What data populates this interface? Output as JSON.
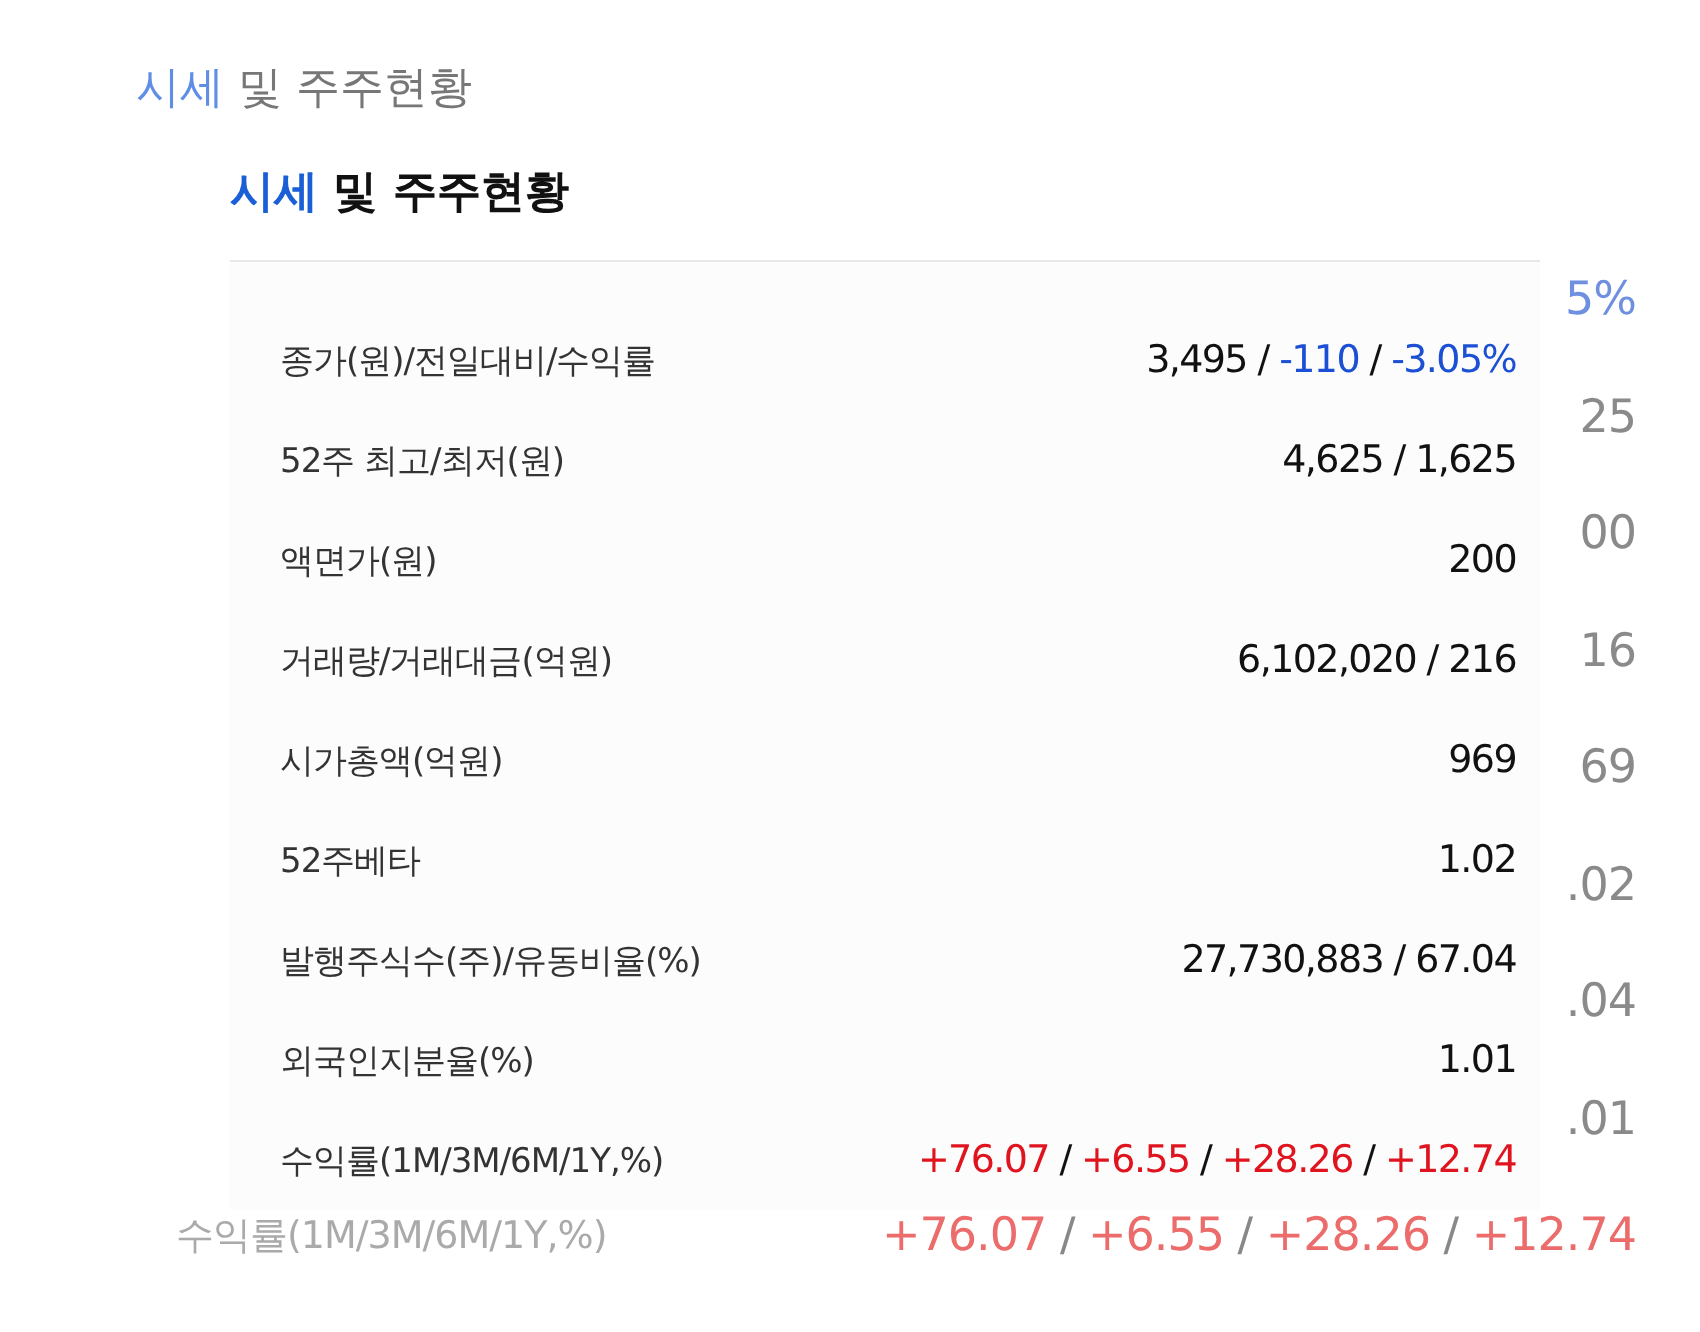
{
  "background": {
    "title": {
      "accent": "시세",
      "rest": "및 주주현황"
    },
    "values": [
      {
        "text": "5%",
        "kind": "down"
      },
      {
        "text": "25",
        "kind": "plain"
      },
      {
        "text": "00",
        "kind": "plain"
      },
      {
        "text": "16",
        "kind": "plain"
      },
      {
        "text": "69",
        "kind": "plain"
      },
      {
        "text": ".02",
        "kind": "plain"
      },
      {
        "text": ".04",
        "kind": "plain"
      },
      {
        "text": ".01",
        "kind": "plain"
      }
    ],
    "last_row": {
      "label": "수익률(1M/3M/6M/1Y,%)",
      "parts": [
        {
          "text": "+76.07",
          "kind": "up"
        },
        {
          "text": " / ",
          "kind": "plain"
        },
        {
          "text": "+6.55",
          "kind": "up"
        },
        {
          "text": " / ",
          "kind": "plain"
        },
        {
          "text": "+28.26",
          "kind": "up"
        },
        {
          "text": " / ",
          "kind": "plain"
        },
        {
          "text": "+12.74",
          "kind": "up"
        }
      ]
    }
  },
  "card": {
    "title": {
      "accent": "시세",
      "rest": "및 주주현황"
    },
    "rows": [
      {
        "label": "종가(원)/전일대비/수익률",
        "parts": [
          {
            "text": "3,495 / ",
            "kind": "plain"
          },
          {
            "text": "-110",
            "kind": "down"
          },
          {
            "text": " / ",
            "kind": "plain"
          },
          {
            "text": "-3.05%",
            "kind": "down"
          }
        ]
      },
      {
        "label": "52주 최고/최저(원)",
        "parts": [
          {
            "text": "4,625 / 1,625",
            "kind": "plain"
          }
        ]
      },
      {
        "label": "액면가(원)",
        "parts": [
          {
            "text": "200",
            "kind": "plain"
          }
        ]
      },
      {
        "label": "거래량/거래대금(억원)",
        "parts": [
          {
            "text": "6,102,020 / 216",
            "kind": "plain"
          }
        ]
      },
      {
        "label": "시가총액(억원)",
        "parts": [
          {
            "text": "969",
            "kind": "plain"
          }
        ]
      },
      {
        "label": "52주베타",
        "parts": [
          {
            "text": "1.02",
            "kind": "plain"
          }
        ]
      },
      {
        "label": "발행주식수(주)/유동비율(%)",
        "parts": [
          {
            "text": "27,730,883 / 67.04",
            "kind": "plain"
          }
        ]
      },
      {
        "label": "외국인지분율(%)",
        "parts": [
          {
            "text": "1.01",
            "kind": "plain"
          }
        ]
      },
      {
        "label": "수익률(1M/3M/6M/1Y,%)",
        "parts": [
          {
            "text": "+76.07",
            "kind": "up"
          },
          {
            "text": " / ",
            "kind": "plain"
          },
          {
            "text": "+6.55",
            "kind": "up"
          },
          {
            "text": " / ",
            "kind": "plain"
          },
          {
            "text": "+28.26",
            "kind": "up"
          },
          {
            "text": " / ",
            "kind": "plain"
          },
          {
            "text": "+12.74",
            "kind": "up"
          }
        ]
      }
    ]
  }
}
